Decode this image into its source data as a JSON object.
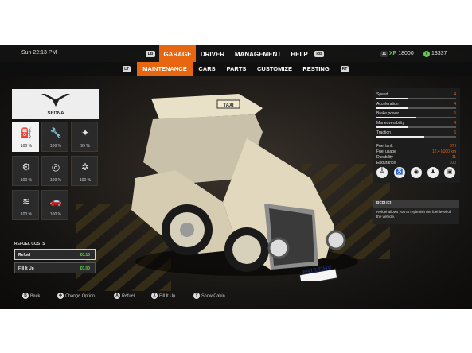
{
  "topbar": {
    "time": "Sun  22:13 PM",
    "nav": [
      "GARAGE",
      "DRIVER",
      "MANAGEMENT",
      "HELP"
    ],
    "active_nav": "GARAGE",
    "lb": "LB",
    "rb": "RB",
    "xp_level": "11",
    "xp_label": "XP",
    "xp_value": "18000",
    "money": "13337"
  },
  "subnav": {
    "lt": "LT",
    "rt": "RT",
    "items": [
      "MAINTENANCE",
      "CARS",
      "PARTS",
      "CUSTOMIZE",
      "RESTING"
    ],
    "active": "MAINTENANCE"
  },
  "brand": {
    "name": "SEDNA"
  },
  "maintenance": [
    {
      "icon": "fuel-pump-icon",
      "glyph": "⛽",
      "value": "100 %"
    },
    {
      "icon": "wrench-icon",
      "glyph": "🔧",
      "value": "100 %"
    },
    {
      "icon": "sparkle-icon",
      "glyph": "✦",
      "value": "99 %"
    },
    {
      "icon": "engine-icon",
      "glyph": "⚙",
      "value": "100 %"
    },
    {
      "icon": "brake-disc-icon",
      "glyph": "◎",
      "value": "100 %"
    },
    {
      "icon": "wheel-icon",
      "glyph": "✲",
      "value": "100 %"
    },
    {
      "icon": "heater-icon",
      "glyph": "≋",
      "value": "100 %"
    },
    {
      "icon": "car-body-icon",
      "glyph": "🚗",
      "value": "100 %"
    }
  ],
  "refuel_costs": {
    "title": "REFUEL COSTS",
    "rows": [
      {
        "label": "Refuel",
        "value": "€0.10"
      },
      {
        "label": "Fill It Up",
        "value": "€0.00"
      }
    ]
  },
  "stats": [
    {
      "name": "Speed",
      "value": "4",
      "level": 0.4
    },
    {
      "name": "Acceleration",
      "value": "4",
      "level": 0.4
    },
    {
      "name": "Brake power",
      "value": "5",
      "level": 0.5
    },
    {
      "name": "Maneuverability",
      "value": "4",
      "level": 0.4
    },
    {
      "name": "Traction",
      "value": "6",
      "level": 0.6
    }
  ],
  "info": [
    {
      "name": "Fuel tank",
      "value": "37 l"
    },
    {
      "name": "Fuel usage",
      "value": "12.4 l/100 km"
    },
    {
      "name": "Durability",
      "value": "11"
    },
    {
      "name": "Endurance",
      "value": "100"
    }
  ],
  "badges": [
    {
      "icon": "language-icon",
      "glyph": "Aͤ"
    },
    {
      "icon": "accessibility-icon",
      "glyph": "♿"
    },
    {
      "icon": "camera-icon",
      "glyph": "◉"
    },
    {
      "icon": "passenger-icon",
      "glyph": "♟"
    },
    {
      "icon": "luggage-icon",
      "glyph": "▣"
    }
  ],
  "refuel_panel": {
    "title": "REFUEL",
    "text": "Refuel allows you to replenish the fuel level of the vehicle."
  },
  "car": {
    "plate": "6913 DHV",
    "taxi_sign": "TAXI"
  },
  "hints": [
    {
      "button": "B",
      "label": "Back"
    },
    {
      "button": "✥",
      "label": "Change Option"
    },
    {
      "button": "A",
      "label": "Refuel"
    },
    {
      "button": "X",
      "label": "Fill It Up"
    },
    {
      "button": "Y",
      "label": "Show Cabin"
    }
  ],
  "colors": {
    "accent": "#e8660f",
    "positive": "#5fcf4a"
  }
}
